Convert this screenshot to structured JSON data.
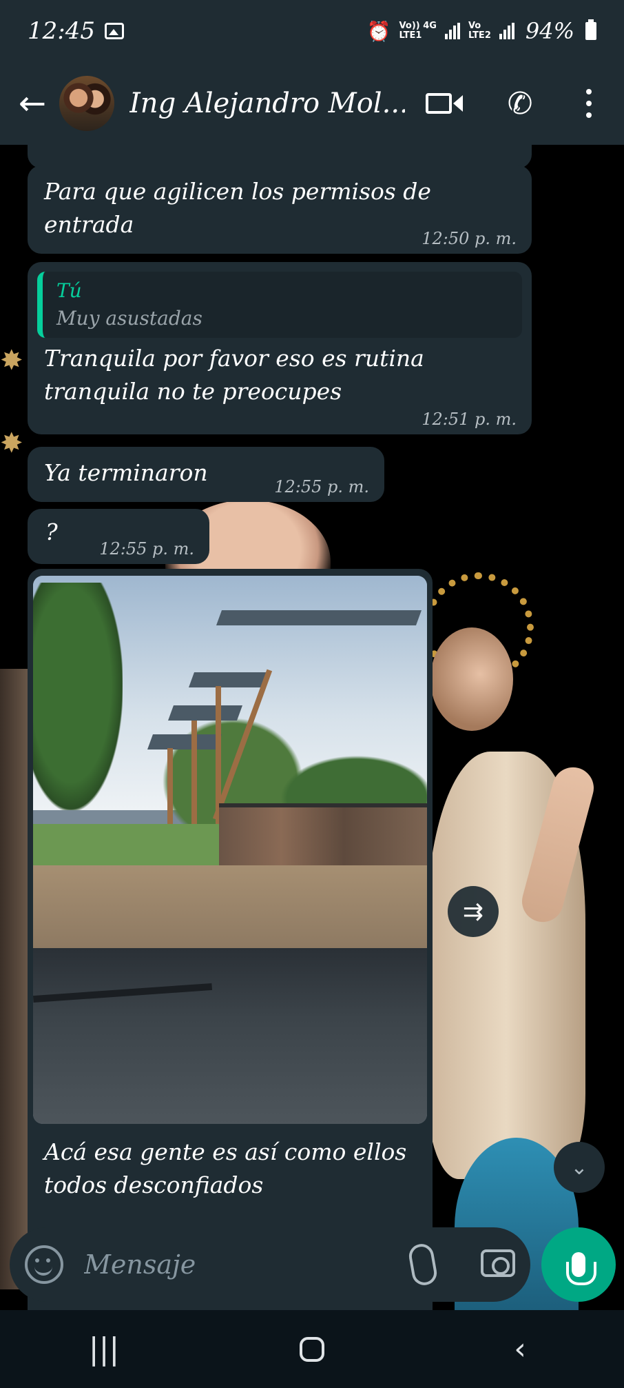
{
  "status_bar": {
    "time": "12:45",
    "carrier1": "Vo)) 4G",
    "carrier1_sub": "LTE1",
    "carrier2": "Vo",
    "carrier2_sub": "LTE2",
    "battery": "94%"
  },
  "header": {
    "contact_name": "Ing Alejandro Mol..."
  },
  "messages": [
    {
      "text": "Para que agilicen los permisos de entrada",
      "time": "12:50 p. m."
    },
    {
      "reply_to_name": "Tú",
      "reply_to_text": "Muy asustadas",
      "text": "Tranquila por favor eso es rutina tranquila no te preocupes",
      "time": "12:51 p. m."
    },
    {
      "text": "Ya terminaron",
      "time": "12:55 p. m."
    },
    {
      "text": "?",
      "time": "12:55 p. m."
    },
    {
      "text": "Acá esa gente es así como ellos todos desconfiados"
    }
  ],
  "input": {
    "placeholder": "Mensaje"
  },
  "colors": {
    "header_bg": "#1f2c33",
    "bubble_bg": "#1f2c33",
    "accent": "#00a884",
    "reply_bar": "#06cf9c"
  },
  "icons": [
    "back-arrow-icon",
    "video-call-icon",
    "phone-icon",
    "more-options-icon",
    "emoji-icon",
    "attach-icon",
    "camera-icon",
    "mic-icon",
    "forward-icon",
    "scroll-down-icon"
  ]
}
